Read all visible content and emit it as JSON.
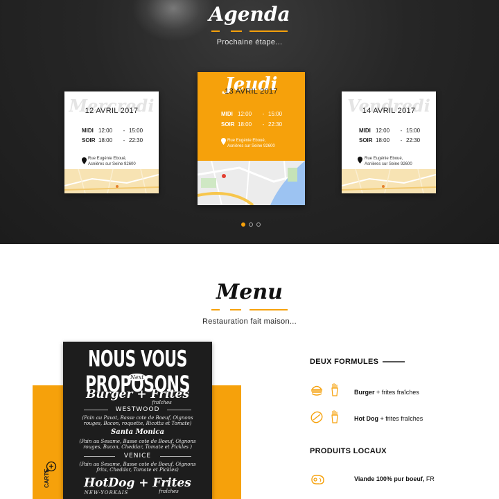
{
  "agenda": {
    "title": "Agenda",
    "subtitle": "Prochaine étape...",
    "cards": [
      {
        "day": "Mercredi",
        "date": "12 AVRIL 2017",
        "midi_label": "MIDI",
        "midi_start": "12:00",
        "midi_end": "15:00",
        "soir_label": "SOIR",
        "soir_start": "18:00",
        "soir_end": "22:30",
        "address_line1": "Rue Eugénie Eboué,",
        "address_line2": "Asnières sur Seine 92600"
      },
      {
        "day": "Jeudi",
        "date": "13 AVRIL 2017",
        "midi_label": "MIDI",
        "midi_start": "12:00",
        "midi_end": "15:00",
        "soir_label": "SOIR",
        "soir_start": "18:00",
        "soir_end": "22:30",
        "address_line1": "Rue Eugénie Eboué,",
        "address_line2": "Asnières sur Seine 92600"
      },
      {
        "day": "Vendredi",
        "date": "14 AVRIL 2017",
        "midi_label": "MIDI",
        "midi_start": "12:00",
        "midi_end": "15:00",
        "soir_label": "SOIR",
        "soir_start": "18:00",
        "soir_end": "22:30",
        "address_line1": "Rue Eugénie Eboué,",
        "address_line2": "Asnières sur Seine 92600"
      }
    ],
    "dash": "-",
    "carousel_active_index": 0,
    "carousel_count": 3
  },
  "menu": {
    "title": "Menu",
    "subtitle": "Restauration fait maison...",
    "side_label": "CARTE",
    "board": {
      "heading": "NOUS VOUS PROPOSONS",
      "next": "Next",
      "burger": "Burger + Frites",
      "burger_frites_note": "fraîches",
      "westwood": "WESTWOOD",
      "westwood_desc1": "(Pain au Pavot, Basse cote de Boeuf, Oignons",
      "westwood_desc2": "rouges, Bacon, roquette, Ricotta et Tomate)",
      "santa_monica": "Santa Monica",
      "santa_desc1": "(Pain au Sesame, Basse cote de Boeuf, Oignons",
      "santa_desc2": "rouges, Bacon, Cheddar, Tomate et Pickles )",
      "venice": "VENICE",
      "venice_desc1": "(Pain au Sesame, Basse cote de Boeuf, Oignons",
      "venice_desc2": "frits, Cheddar, Tomate et Pickles)",
      "hotdog": "HotDog + Frites",
      "hotdog_sub": "NEW-YORKAIS",
      "hotdog_frites_note": "fraîches"
    },
    "formules": {
      "heading": "DEUX FORMULES",
      "items": [
        {
          "bold": "Burger",
          "rest": " + frites fraîches",
          "icon": "burger-icon"
        },
        {
          "bold": "Hot Dog",
          "rest": " + frites fraîches",
          "icon": "hotdog-icon"
        }
      ]
    },
    "produits": {
      "heading": "PRODUITS LOCAUX",
      "items": [
        {
          "bold": "Viande 100% pur boeuf,",
          "rest": " FR",
          "icon": "meat-icon"
        }
      ]
    }
  },
  "colors": {
    "accent": "#f6a10b",
    "dark_bg": "#262626",
    "map_bg": "#f7e3b3"
  }
}
